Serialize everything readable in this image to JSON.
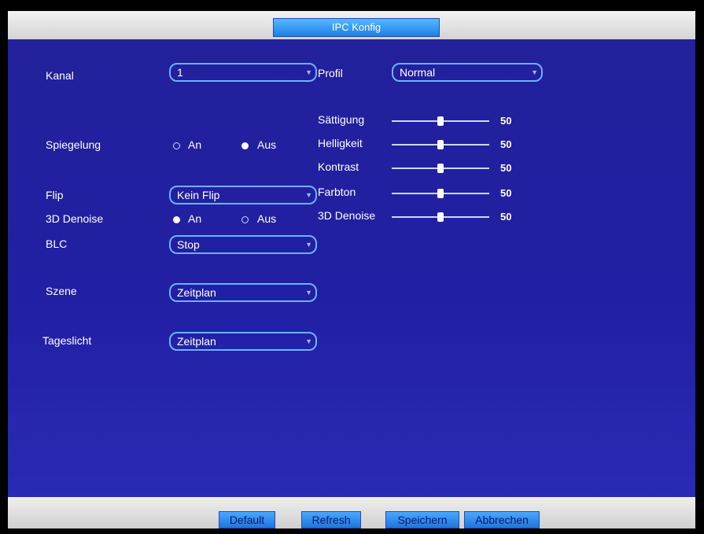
{
  "window": {
    "title": "IPC Konfig"
  },
  "fields": {
    "kanal": {
      "label": "Kanal",
      "value": "1"
    },
    "profil": {
      "label": "Profil",
      "value": "Normal"
    },
    "flip": {
      "label": "Flip",
      "value": "Kein Flip"
    },
    "blc": {
      "label": "BLC",
      "value": "Stop"
    },
    "szene": {
      "label": "Szene",
      "value": "Zeitplan"
    },
    "tageslicht": {
      "label": "Tageslicht",
      "value": "Zeitplan"
    }
  },
  "radios": {
    "spiegelung": {
      "label": "Spiegelung",
      "on_label": "An",
      "off_label": "Aus",
      "selected": "Aus"
    },
    "denoise": {
      "label": "3D Denoise",
      "on_label": "An",
      "off_label": "Aus",
      "selected": "An"
    }
  },
  "sliders": [
    {
      "label": "Sättigung",
      "value": "50",
      "level": 0.5
    },
    {
      "label": "Helligkeit",
      "value": "50",
      "level": 0.5
    },
    {
      "label": "Kontrast",
      "value": "50",
      "level": 0.5
    },
    {
      "label": "Farbton",
      "value": "50",
      "level": 0.5
    },
    {
      "label": "3D Denoise",
      "value": "50",
      "level": 0.5
    }
  ],
  "buttons": {
    "default": "Default",
    "refresh": "Refresh",
    "speichern": "Speichern",
    "abbrechen": "Abbrechen"
  },
  "colors": {
    "background": "#2320a0",
    "accent": "#3a95f5",
    "field_border": "#6fb0ff"
  }
}
